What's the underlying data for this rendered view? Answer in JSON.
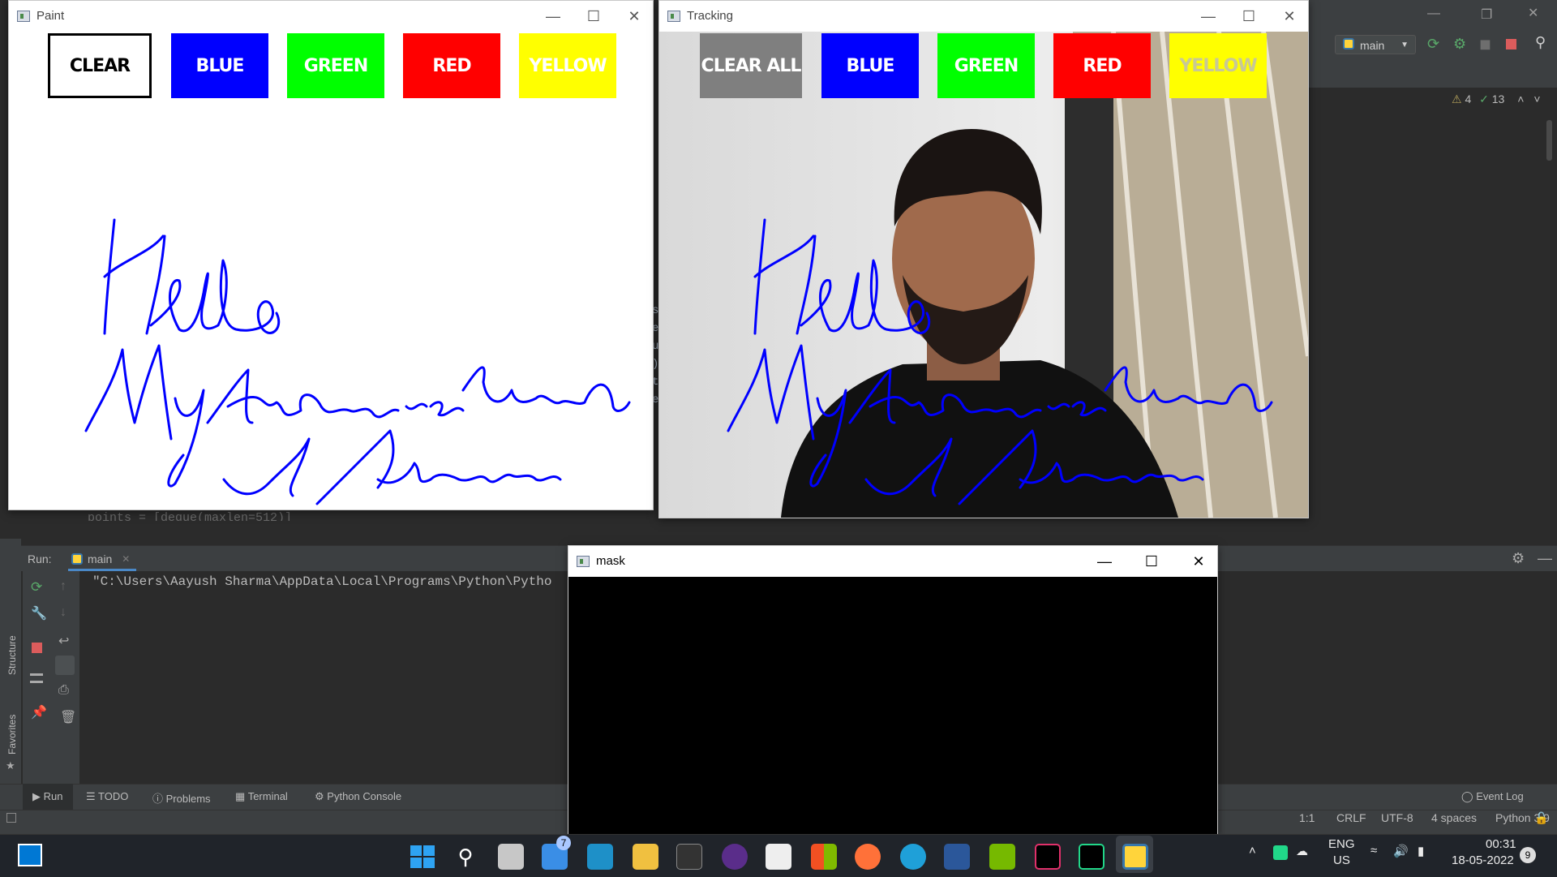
{
  "ide": {
    "branch": "main",
    "inspections": {
      "warnings": "4",
      "ok": "13"
    },
    "code_peek": "points = [deque(maxlen=512)]",
    "run": {
      "label": "Run:",
      "tab": "main",
      "console_line": "\"C:\\Users\\Aayush Sharma\\AppData\\Local\\Programs\\Python\\Pytho"
    },
    "side_tabs": [
      "Structure",
      "Favorites"
    ],
    "bottom_tools": [
      "Run",
      "TODO",
      "Problems",
      "Terminal",
      "Python Console"
    ],
    "event_log": "Event Log",
    "status": [
      "1:1",
      "CRLF",
      "UTF-8",
      "4 spaces",
      "Python 3.9"
    ],
    "gutter_chars": [
      "s",
      "e",
      "u",
      ")",
      "t",
      "e"
    ]
  },
  "paint_window": {
    "title": "Paint",
    "buttons": [
      {
        "label": "CLEAR",
        "color": "#ffffff",
        "text_color": "#000000",
        "border": "#000000"
      },
      {
        "label": "BLUE",
        "color": "#0000ff",
        "text_color": "#ffffff"
      },
      {
        "label": "GREEN",
        "color": "#00ff00",
        "text_color": "#ffffff"
      },
      {
        "label": "RED",
        "color": "#ff0000",
        "text_color": "#ffffff"
      },
      {
        "label": "YELLOW",
        "color": "#ffff00",
        "text_color": "#ffffff"
      }
    ],
    "drawing_text": [
      "Hello",
      "My Name is Aayush",
      "Sharma"
    ],
    "ink_color": "#0000ff"
  },
  "tracking_window": {
    "title": "Tracking",
    "buttons": [
      {
        "label": "CLEAR ALL",
        "color": "#7f7f7f",
        "text_color": "#ffffff"
      },
      {
        "label": "BLUE",
        "color": "#0000ff",
        "text_color": "#ffffff"
      },
      {
        "label": "GREEN",
        "color": "#00ff00",
        "text_color": "#ffffff"
      },
      {
        "label": "RED",
        "color": "#ff0000",
        "text_color": "#ffffff"
      },
      {
        "label": "YELLOW",
        "color": "#ffff00",
        "text_color": "#c8c896"
      }
    ]
  },
  "mask_window": {
    "title": "mask"
  },
  "taskbar": {
    "mail_badge": "7",
    "tray": {
      "lang1": "ENG",
      "lang2": "US",
      "time": "00:31",
      "date": "18-05-2022",
      "notifications": "9"
    }
  }
}
